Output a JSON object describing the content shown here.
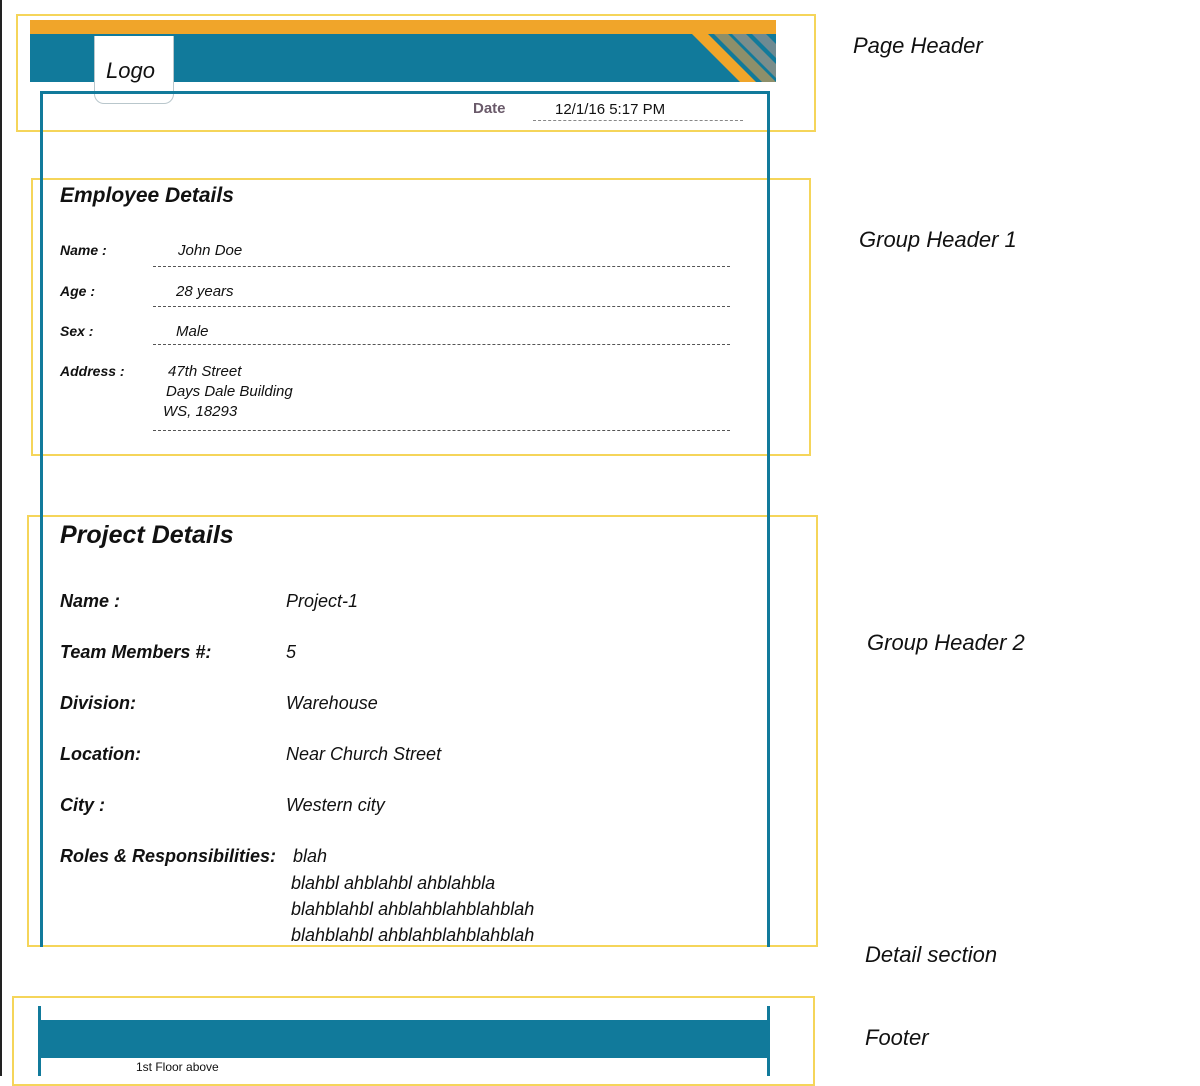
{
  "header": {
    "logo_text": "Logo",
    "date_label": "Date",
    "date_value": "12/1/16 5:17 PM"
  },
  "employee": {
    "title": "Employee Details",
    "fields": [
      {
        "label": "Name  :",
        "value": "John Doe"
      },
      {
        "label": "Age   :",
        "value": "28 years"
      },
      {
        "label": "Sex   :",
        "value": "Male"
      },
      {
        "label": "Address :",
        "value_lines": [
          "47th Street",
          "Days Dale Building",
          "WS, 18293"
        ]
      }
    ]
  },
  "project": {
    "title": "Project Details",
    "fields": [
      {
        "label": "Name :",
        "value": "Project-1"
      },
      {
        "label": "Team Members #:",
        "value": "5"
      },
      {
        "label": "Division:",
        "value": "Warehouse"
      },
      {
        "label": "Location:",
        "value": "Near Church Street"
      },
      {
        "label": "City :",
        "value": "Western city"
      },
      {
        "label": "Roles & Responsibilities:",
        "value_lines": [
          "blah",
          "blahbl ahblahbl ahblahbla",
          "blahblahbl ahblahblahblahblah",
          "blahblahbl ahblahblahblahblah"
        ]
      }
    ]
  },
  "footer": {
    "text": "1st Floor above"
  },
  "annotations": {
    "page_header": "Page Header",
    "group_header_1": "Group Header 1",
    "group_header_2": "Group Header 2",
    "detail_section": "Detail section",
    "footer": "Footer"
  },
  "colors": {
    "teal": "#117a9b",
    "orange": "#f0a52a",
    "highlight_outline": "#f5d55a"
  }
}
